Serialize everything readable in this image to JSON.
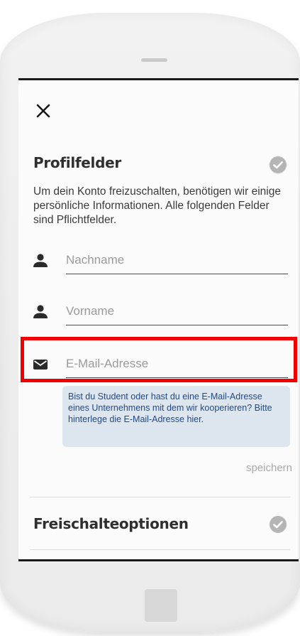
{
  "colors": {
    "accent_highlight": "#f00000",
    "hint_background": "#dde5ee",
    "hint_text": "#1f4a86",
    "title_text": "#2f2f2f",
    "check_circle": "#b5b5b5"
  },
  "header": {
    "close_icon": "close-icon"
  },
  "profile_section": {
    "title": "Profilfelder",
    "status_icon": "check-circle-icon",
    "intro": "Um dein Konto freizuschalten, benötigen wir einige persönliche Informationen. Alle folgenden Felder sind Pflichtfelder.",
    "fields": {
      "nachname": {
        "icon": "person-icon",
        "placeholder": "Nachname",
        "value": ""
      },
      "vorname": {
        "icon": "person-icon",
        "placeholder": "Vorname",
        "value": ""
      },
      "email": {
        "icon": "envelope-icon",
        "placeholder": "E-Mail-Adresse",
        "value": ""
      }
    },
    "email_hint": "Bist du Student oder hast du eine E-Mail-Adresse eines Unternehmens mit dem wir kooperieren? Bitte hinterlege die E-Mail-Adresse hier.",
    "save_label": "speichern"
  },
  "unlock_section": {
    "title": "Freischalteoptionen",
    "status_icon": "check-circle-icon"
  }
}
